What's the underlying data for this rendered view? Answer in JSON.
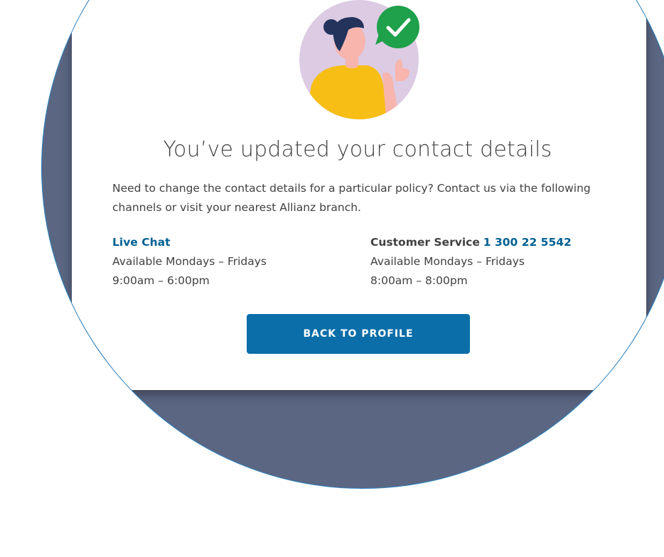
{
  "success": {
    "title": "You’ve updated your contact details",
    "intro": "Need to change the contact details for a particular policy? Contact us via the following channels or visit your nearest Allianz branch."
  },
  "live_chat": {
    "label": "Live Chat",
    "availability": "Available Mondays – Fridays",
    "hours": "9:00am – 6:00pm"
  },
  "customer_service": {
    "label": "Customer Service",
    "phone": "1 300 22 5542",
    "availability": "Available Mondays – Fridays",
    "hours": "8:00am – 8:00pm"
  },
  "actions": {
    "back_to_profile": "BACK TO PROFILE"
  },
  "colors": {
    "primary": "#0b6ea8",
    "link": "#006192",
    "success_green": "#1fa04a",
    "backdrop": "#5b6682",
    "text": "#414141"
  },
  "icons": {
    "illustration": "person-thumbs-up-illustration",
    "badge": "checkmark-badge-icon"
  }
}
